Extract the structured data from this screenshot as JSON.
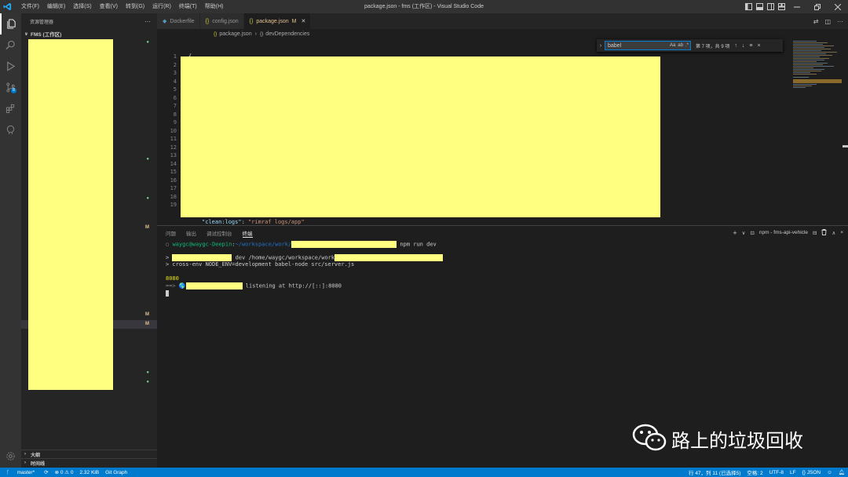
{
  "window_title": "package.json - fms (工作区) - Visual Studio Code",
  "menu": [
    "文件(F)",
    "编辑(E)",
    "选择(S)",
    "查看(V)",
    "转到(G)",
    "运行(R)",
    "终端(T)",
    "帮助(H)"
  ],
  "sidebar": {
    "title": "资源管理器",
    "more": "···",
    "folder": "FMS (工作区)",
    "sections": [
      "大纲",
      "时间线"
    ]
  },
  "activity_badge": "8",
  "tabs": [
    {
      "label": "Dockerfile",
      "icon": "whale-icon",
      "active": false
    },
    {
      "label": "config.json",
      "icon": "braces-icon",
      "active": false
    },
    {
      "label": "package.json",
      "icon": "braces-icon",
      "active": true,
      "modified": "M"
    }
  ],
  "breadcrumb": {
    "file": "package.json",
    "node": "devDependencies"
  },
  "line_numbers": [
    "1",
    "2",
    "3",
    "4",
    "5",
    "6",
    "7",
    "8",
    "9",
    "10",
    "11",
    "12",
    "13",
    "14",
    "15",
    "16",
    "17",
    "18",
    "19"
  ],
  "code": {
    "line1": "{",
    "line20_key": "\"clean:logs\"",
    "line20_sep": ": ",
    "line20_val": "\"rimraf logs/app\""
  },
  "find": {
    "query": "babel",
    "options": [
      "Aa",
      "ab",
      ".*"
    ],
    "count": "第 7 项，共 9 项",
    "buttons": [
      "↑",
      "↓",
      "≡",
      "×"
    ]
  },
  "panel": {
    "tabs": [
      "问题",
      "输出",
      "调试控制台",
      "终端"
    ],
    "active_tab": "终端",
    "terminal_name": "npm - fms-api-vehicle",
    "actions": [
      "+",
      "∨",
      "⊟",
      "🗑",
      "∧",
      "×"
    ]
  },
  "terminal": {
    "prompt_user": "waygc@waygc-Deepin",
    "prompt_sep": ":",
    "prompt_path": "~/workspace/work/",
    "command": " npm run dev",
    "line2_mid": " dev /home/waygc/workspace/work",
    "line3": "> cross-env NODE_ENV=development babel-node src/server.js",
    "port": "8080",
    "listen_prefix": "==> 🌎",
    "listen_suffix": " listening at http://[::]:8080"
  },
  "watermark": "路上的垃圾回收",
  "statusbar": {
    "branch": "master*",
    "sync": "⟳",
    "problems": "⊗ 0 ⚠ 0",
    "size": "2.32 KiB",
    "git_graph": "Git Graph",
    "position": "行 47，列 11 (已选择5)",
    "indent": "空格: 2",
    "encoding": "UTF-8",
    "eol": "LF",
    "language": "{} JSON"
  },
  "colors": {
    "accent": "#007acc",
    "redaction": "#ffff80",
    "git_added": "#73c991",
    "git_modified": "#e2c08d"
  }
}
